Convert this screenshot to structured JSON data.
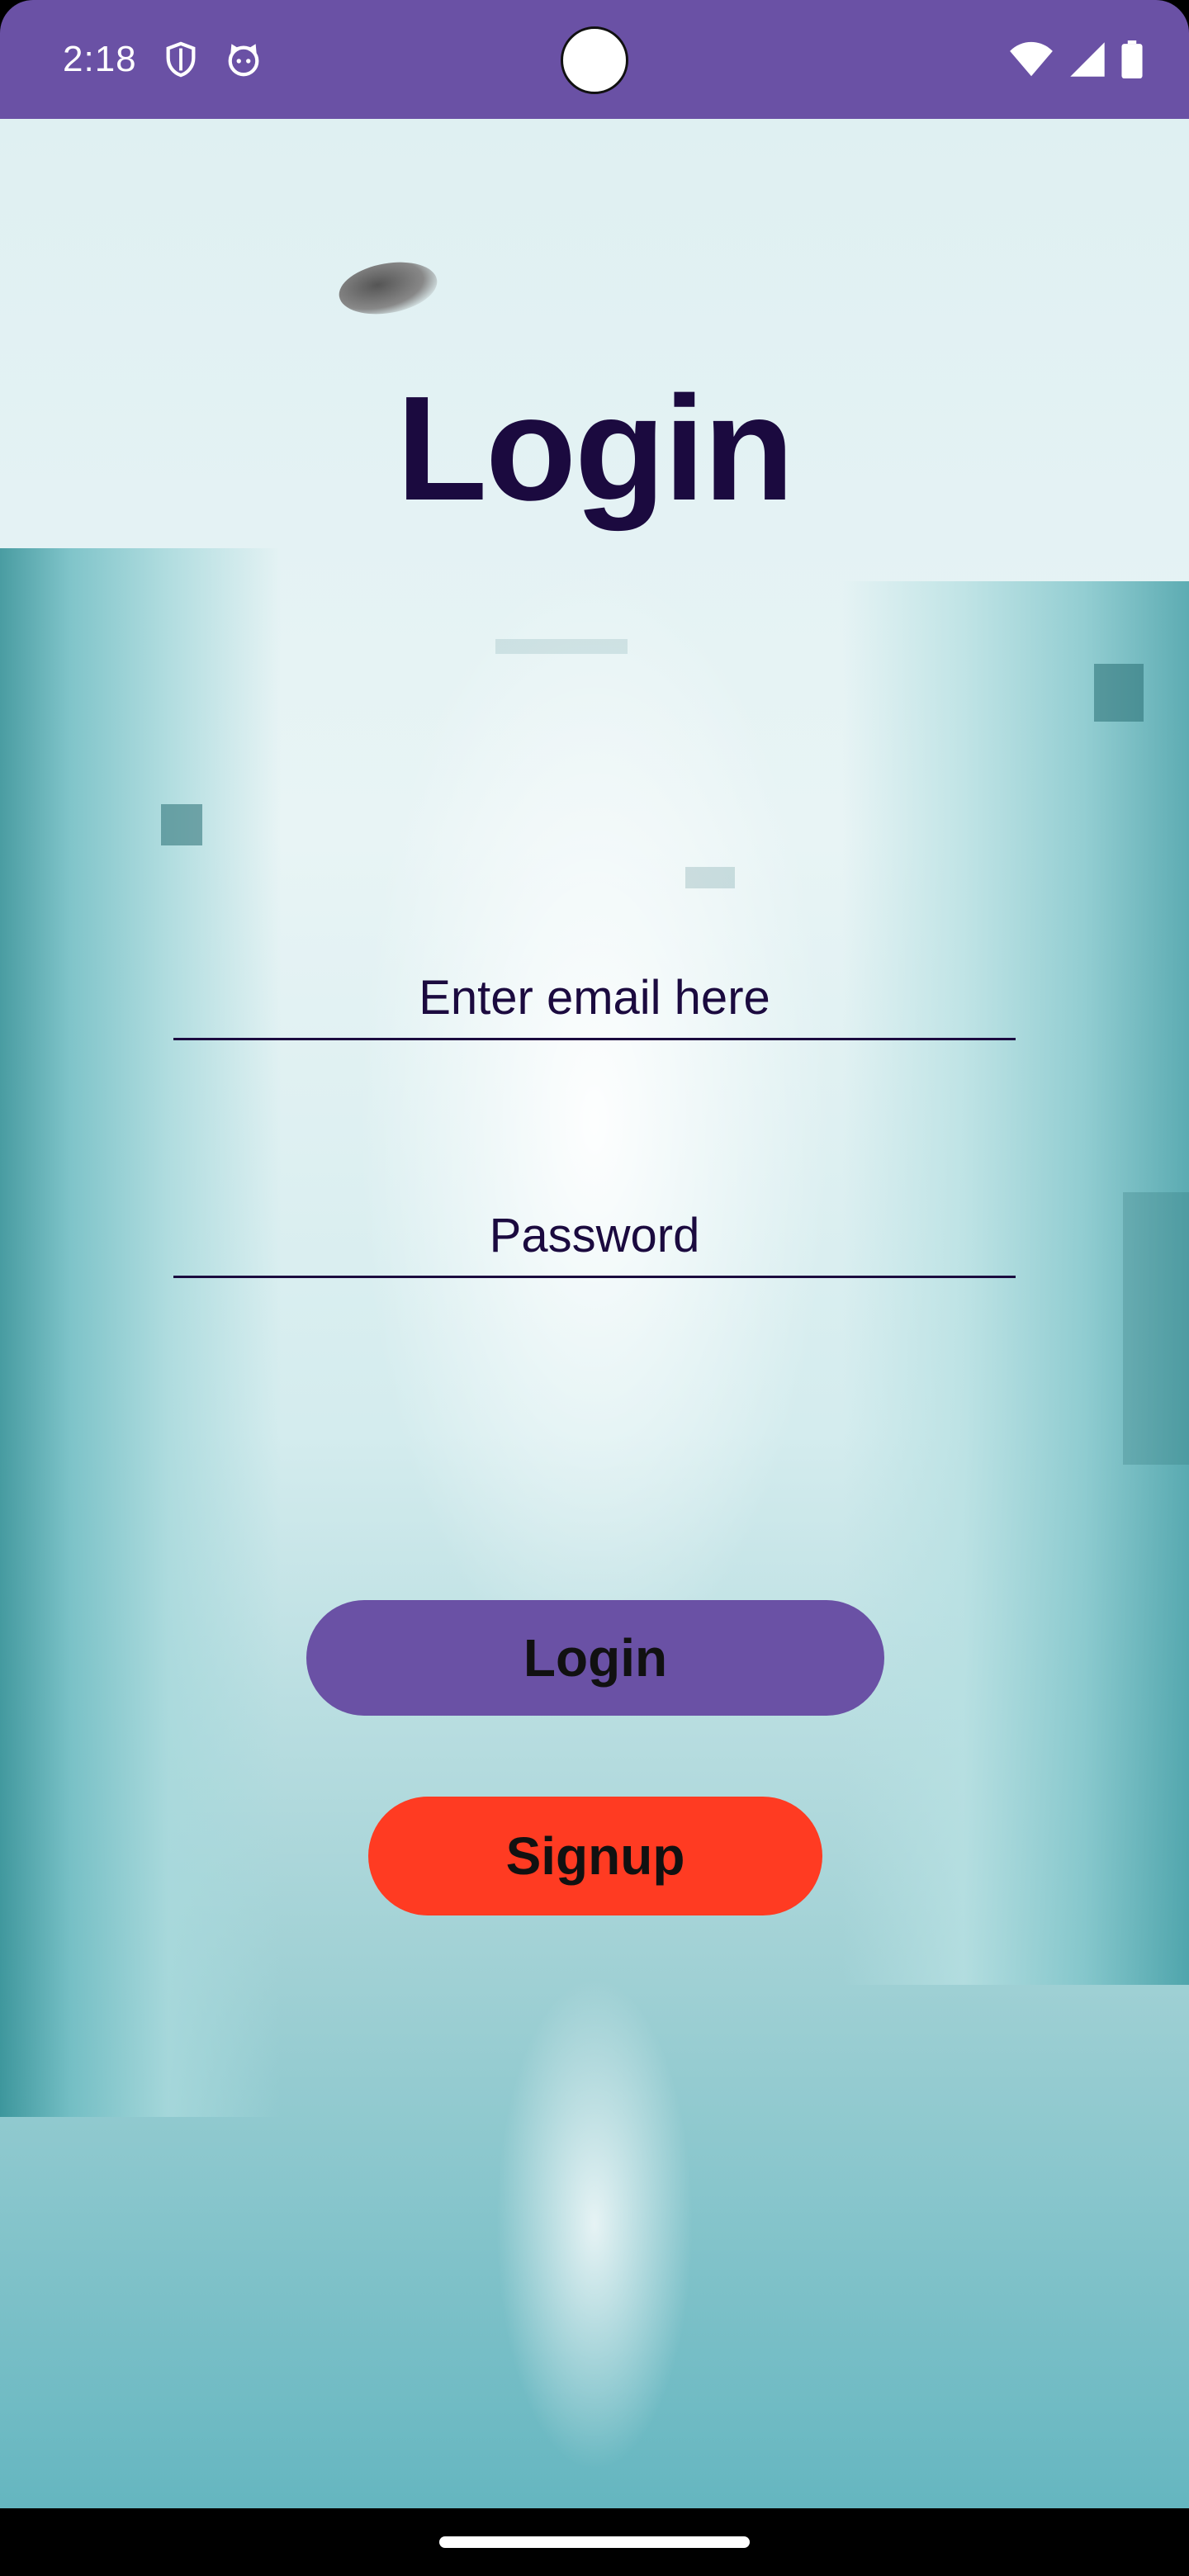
{
  "status_bar": {
    "time": "2:18",
    "icons_left": [
      "shield-icon",
      "cat-face-icon"
    ],
    "icons_right": [
      "wifi-icon",
      "signal-icon",
      "battery-icon"
    ],
    "color": "#6a51a5"
  },
  "login": {
    "title": "Login",
    "email_placeholder": "Enter email here",
    "password_placeholder": "Password",
    "login_label": "Login",
    "signup_label": "Signup"
  },
  "colors": {
    "primary": "#6a51a5",
    "signup": "#ff3b22",
    "title_text": "#1b0a3f"
  }
}
